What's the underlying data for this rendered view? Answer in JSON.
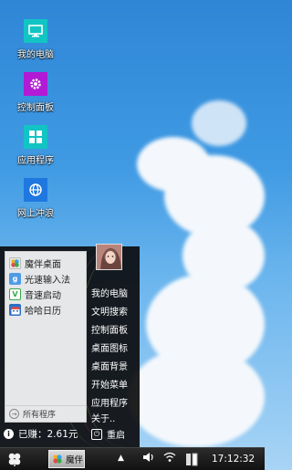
{
  "desktop": {
    "icons": [
      {
        "label": "我的电脑",
        "icon": "monitor-icon",
        "color": "#12c4c4"
      },
      {
        "label": "控制面板",
        "icon": "gear-icon",
        "color": "#b11bd6"
      },
      {
        "label": "应用程序",
        "icon": "apps-grid-icon",
        "color": "#12c4c4"
      },
      {
        "label": "网上冲浪",
        "icon": "globe-icon",
        "color": "#1f78e0"
      }
    ]
  },
  "start_menu": {
    "programs": [
      {
        "label": "魔伴桌面",
        "icon": "mobanzhuomian-app-icon",
        "color": "#3aa0e8"
      },
      {
        "label": "光速输入法",
        "icon": "guangsu-input-icon",
        "color": "#4e9be6"
      },
      {
        "label": "音速启动",
        "icon": "yinsu-launcher-icon",
        "color": "#37a84a"
      },
      {
        "label": "哈哈日历",
        "icon": "calendar-icon",
        "color": "#2c6fc4"
      }
    ],
    "all_programs_label": "所有程序",
    "right_items": [
      "我的电脑",
      "文明搜索",
      "控制面板",
      "桌面图标",
      "桌面背景",
      "开始菜单",
      "应用程序",
      "关于.."
    ],
    "earnings_label": "已赚：2.61元",
    "restart_label": "重启"
  },
  "taskbar": {
    "start_icon": "clover-start-icon",
    "task_label": "魔伴",
    "tray_icons": [
      "arrow-up-icon",
      "volume-icon",
      "wifi-icon",
      "battery-icon"
    ],
    "time": "17:12:32"
  }
}
